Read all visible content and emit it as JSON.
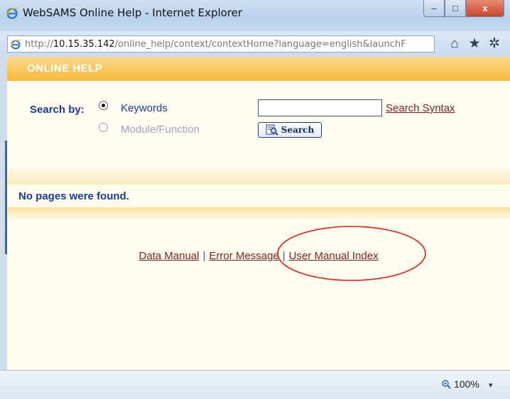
{
  "window": {
    "title": "WebSAMS Online Help - Internet Explorer",
    "min_glyph": "–",
    "max_glyph": "□",
    "close_glyph": "x"
  },
  "address": {
    "url_prefix": "http://",
    "url_host": "10.15.35.142",
    "url_path": "/online_help/context/contextHome?language=english&launchF"
  },
  "toolbar": {
    "home_icon": "⌂",
    "favorites_icon": "★",
    "tools_icon": "✲"
  },
  "header": {
    "label": "ONLINE HELP"
  },
  "search": {
    "label": "Search by:",
    "options": [
      "Keywords",
      "Module/Function"
    ],
    "selected": "Keywords",
    "keyword_value": "",
    "syntax_link": "Search Syntax",
    "button_label": "Search"
  },
  "results": {
    "message": "No pages were found."
  },
  "links": {
    "data_manual": "Data Manual",
    "error_message": "Error Message",
    "user_manual_index": "User Manual Index",
    "separator": "|"
  },
  "status": {
    "zoom": "100%",
    "zoom_caret": "▾"
  },
  "colors": {
    "header": "#f7b93a",
    "link": "#8a1d1d",
    "label_blue": "#1a3aa0",
    "annotation": "#e0201b"
  }
}
